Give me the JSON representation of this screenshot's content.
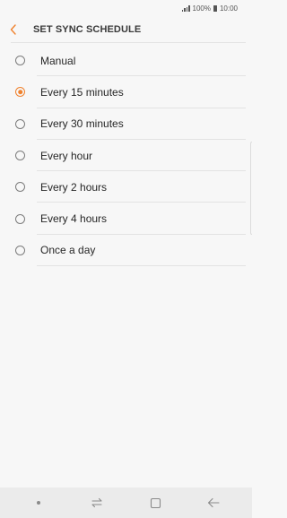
{
  "status": {
    "battery_percent": "100%",
    "time": "10:00"
  },
  "header": {
    "title": "SET SYNC SCHEDULE",
    "back_icon": "chevron-left-icon",
    "accent_color": "#f0822e"
  },
  "options": [
    {
      "label": "Manual",
      "selected": false
    },
    {
      "label": "Every 15 minutes",
      "selected": true
    },
    {
      "label": "Every 30 minutes",
      "selected": false
    },
    {
      "label": "Every hour",
      "selected": false
    },
    {
      "label": "Every 2 hours",
      "selected": false
    },
    {
      "label": "Every 4 hours",
      "selected": false
    },
    {
      "label": "Once a day",
      "selected": false
    }
  ],
  "nav": {
    "items": [
      "dot-icon",
      "recent-apps-icon",
      "home-icon",
      "back-arrow-icon"
    ]
  }
}
